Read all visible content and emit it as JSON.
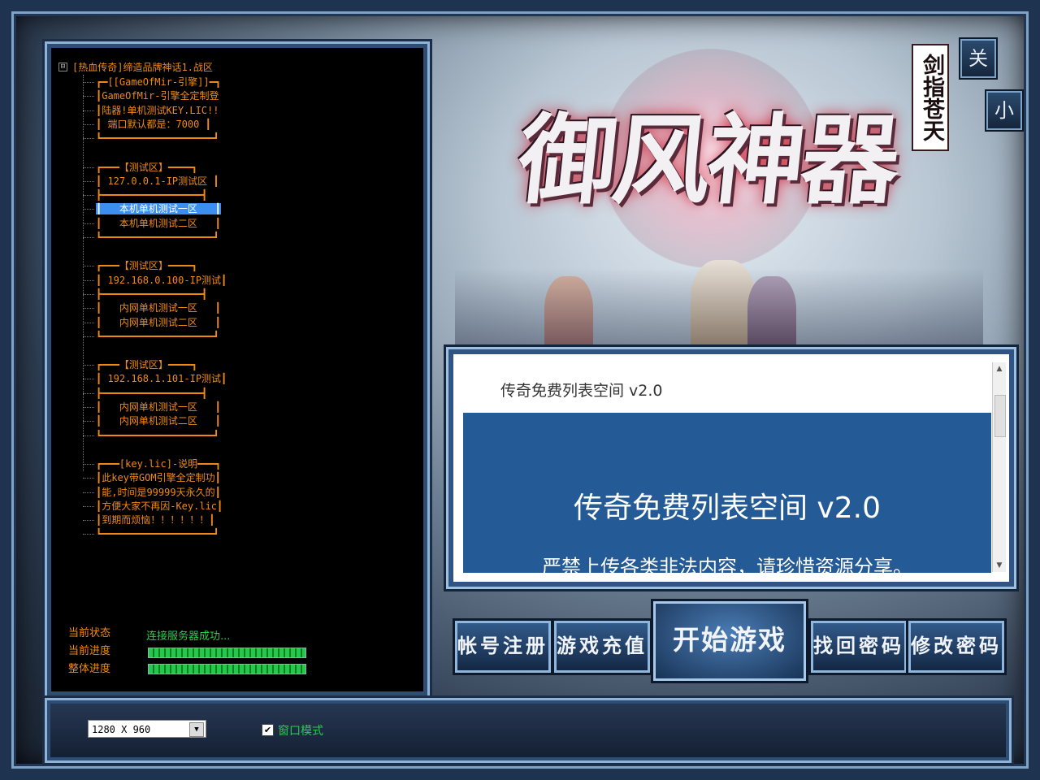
{
  "window": {
    "close_label": "关",
    "minimize_label": "小"
  },
  "logo": {
    "title": "御风神器",
    "subtitle": "剑指苍天"
  },
  "server_tree": {
    "root": "[热血传奇]缔造品牌神话1.战区",
    "toggle": "⊟",
    "nodes": [
      "┏━[[GameOfMir-引擎]]━┓",
      "┃GameOfMir-引擎全定制登",
      "┃陆器!单机测试KEY.LIC!!",
      "┃ 端口默认都是：7000 ┃",
      "┗━━━━━━━━━━━━━━━━━━━┛",
      "┏━━━【测试区】━━━━┓",
      "┃ 127.0.0.1-IP测试区 ┃",
      "┣━━━━━━━━━━━━━━━━━┫",
      "┃   本机单机测试一区   ┃",
      "┃   本机单机测试二区   ┃",
      "┗━━━━━━━━━━━━━━━━━━━┛",
      "┏━━━【测试区】━━━━┓",
      "┃ 192.168.0.100-IP测试┃",
      "┣━━━━━━━━━━━━━━━━━┫",
      "┃   内网单机测试一区   ┃",
      "┃   内网单机测试二区   ┃",
      "┗━━━━━━━━━━━━━━━━━━━┛",
      "┏━━━【测试区】━━━━┓",
      "┃ 192.168.1.101-IP测试┃",
      "┣━━━━━━━━━━━━━━━━━┫",
      "┃   内网单机测试一区   ┃",
      "┃   内网单机测试二区   ┃",
      "┗━━━━━━━━━━━━━━━━━━━┛",
      "┏━━━[key.lic]-说明━━━┓",
      "┃此key带GOM引擎全定制功┃",
      "┃能,时间是99999天永久的┃",
      "┃方便大家不再因-Key.lic┃",
      "┃到期而烦恼！！！！！！┃",
      "┗━━━━━━━━━━━━━━━━━━━┛"
    ],
    "selected_index": 8
  },
  "status": {
    "state_label": "当前状态",
    "state_value": "连接服务器成功...",
    "progress_label": "当前进度",
    "total_label": "整体进度",
    "progress_value": 1.0,
    "total_value": 1.0
  },
  "notice": {
    "header": "传奇免费列表空间 v2.0",
    "title": "传奇免费列表空间 v2.0",
    "text": "严禁上传各类非法内容，请珍惜资源分享。",
    "scroll_up_icon": "▲",
    "scroll_down_icon": "▼"
  },
  "actions": {
    "register": "帐号注册",
    "recharge": "游戏充值",
    "start": "开始游戏",
    "recover": "找回密码",
    "change": "修改密码"
  },
  "bottom": {
    "resolution": "1280 X 960",
    "dropdown_icon": "▼",
    "window_mode_label": "窗口模式",
    "window_mode_checked": "✔"
  }
}
